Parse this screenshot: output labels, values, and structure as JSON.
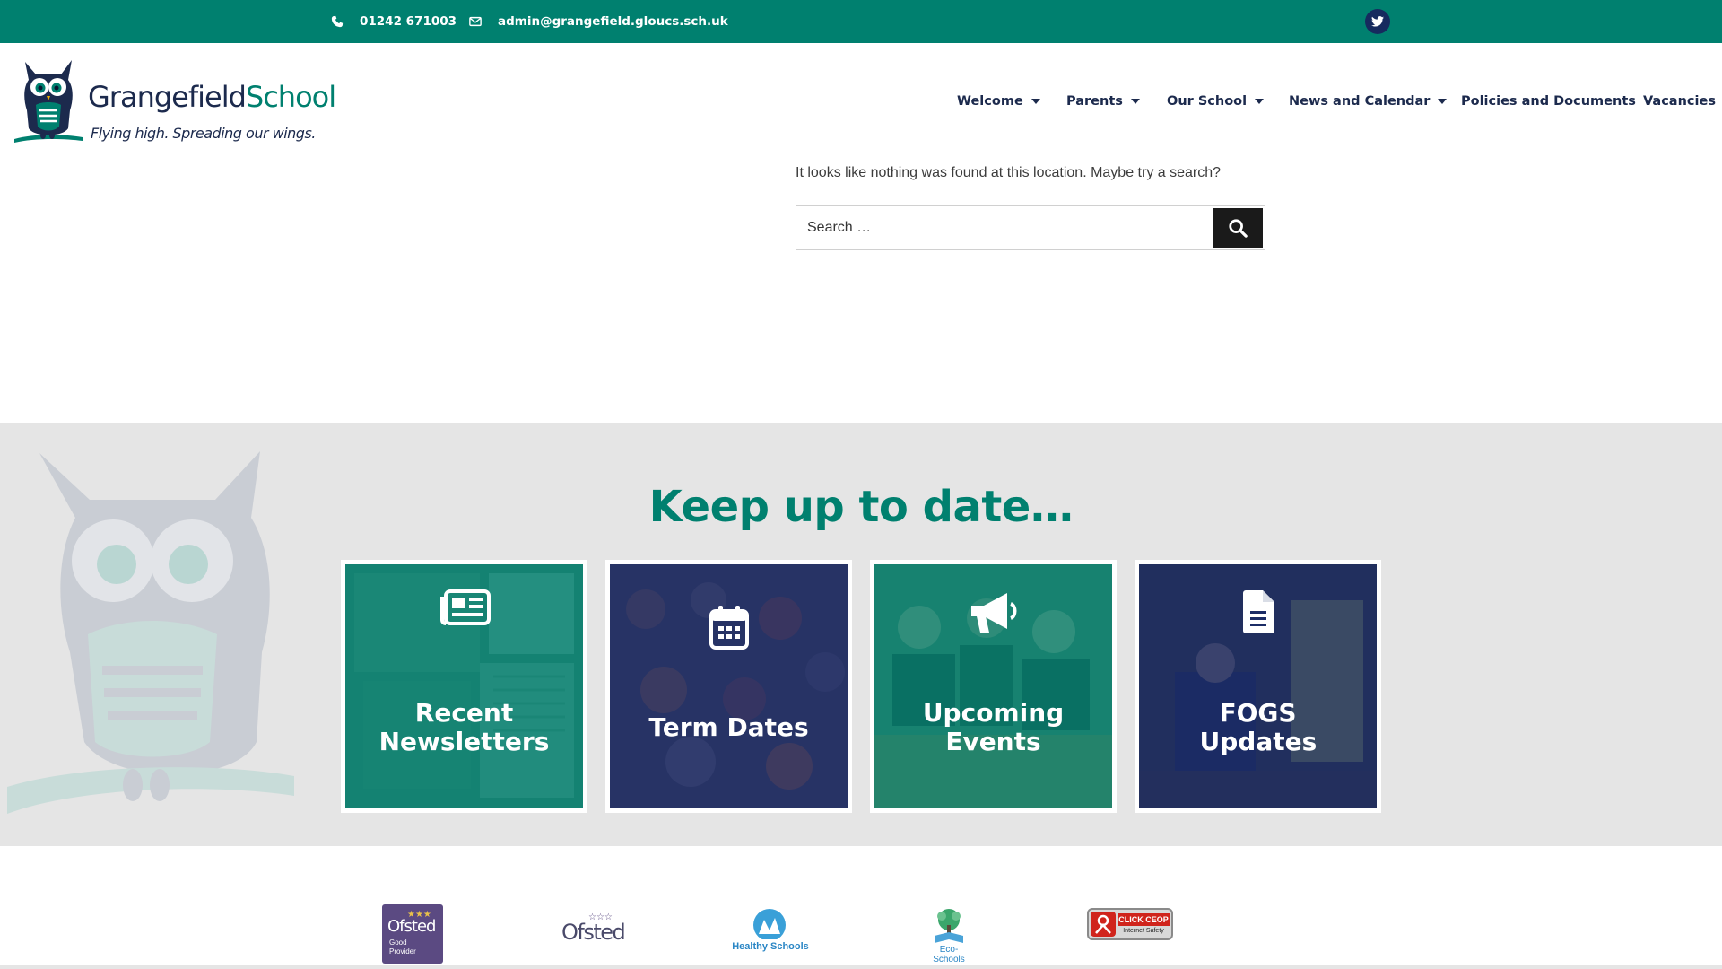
{
  "topbar": {
    "phone": "01242 671003",
    "email": "admin@grangefield.gloucs.sch.uk",
    "twitter_icon": "twitter-icon",
    "color": "#00806f"
  },
  "header": {
    "logo_name_part1": "Grangefield",
    "logo_name_part2": "School",
    "logo_tagline": "Flying high. Spreading our wings."
  },
  "nav": {
    "items": [
      {
        "label": "Welcome",
        "dropdown": true
      },
      {
        "label": "Parents",
        "dropdown": true
      },
      {
        "label": "Our School",
        "dropdown": true
      },
      {
        "label": "News and Calendar",
        "dropdown": true
      },
      {
        "label": "Policies and Documents",
        "dropdown": false
      },
      {
        "label": "Vacancies",
        "dropdown": false
      }
    ]
  },
  "not_found": {
    "message": "It looks like nothing was found at this location. Maybe try a search?",
    "search_placeholder": "Search …",
    "search_icon": "search-icon"
  },
  "updates": {
    "title": "Keep up to date…",
    "cards": [
      {
        "label": "Recent Newsletters",
        "icon": "newspaper-icon",
        "tint": "#00806f"
      },
      {
        "label": "Term Dates",
        "icon": "calendar-icon",
        "tint": "#1b2c66"
      },
      {
        "label": "Upcoming Events",
        "icon": "megaphone-icon",
        "tint": "#00806f"
      },
      {
        "label": "FOGS Updates",
        "icon": "document-icon",
        "tint": "#1b2c66"
      }
    ]
  },
  "badges": {
    "ofsted_good_title": "Ofsted",
    "ofsted_good_line1": "Good",
    "ofsted_good_line2": "Provider",
    "ofsted_title": "Ofsted",
    "healthy_schools": "Healthy Schools",
    "eco_schools": "Eco-Schools",
    "ceop_title": "CLICK CEOP",
    "ceop_sub": "Internet Safety"
  },
  "colors": {
    "teal": "#00806f",
    "navy": "#1c2a4d",
    "grey_band": "#e5e5e5"
  }
}
